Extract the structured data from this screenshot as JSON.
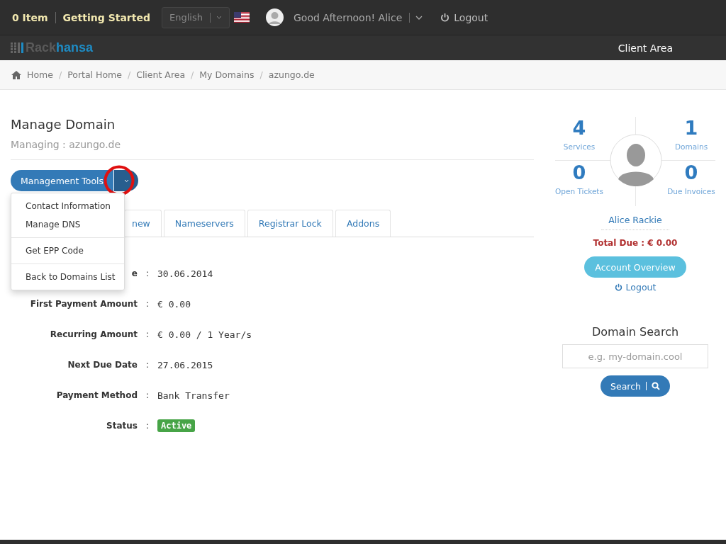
{
  "topbar": {
    "cart": "0 Item",
    "getting_started": "Getting Started",
    "language": "English",
    "greeting": "Good Afternoon! Alice",
    "logout": "Logout"
  },
  "navbar": {
    "logo_left": "Rack",
    "logo_right": "hansa",
    "link": "Client Area"
  },
  "breadcrumb": [
    {
      "kind": "link",
      "text": "Home"
    },
    {
      "kind": "separator",
      "text": "/"
    },
    {
      "kind": "link",
      "text": "Portal Home"
    },
    {
      "kind": "separator",
      "text": "/"
    },
    {
      "kind": "link",
      "text": "Client Area"
    },
    {
      "kind": "separator",
      "text": "/"
    },
    {
      "kind": "link",
      "text": "My Domains"
    },
    {
      "kind": "separator",
      "text": "/"
    },
    {
      "kind": "current",
      "text": "azungo.de"
    }
  ],
  "page": {
    "title": "Manage Domain",
    "subtitle": "Managing : azungo.de"
  },
  "tools": {
    "label": "Management Tools",
    "expanded": true,
    "highlighted": true,
    "menu": [
      {
        "label": "Contact Information",
        "divider_before": false
      },
      {
        "label": "Manage DNS",
        "divider_before": false
      },
      {
        "label": "Get EPP Code",
        "divider_before": true
      },
      {
        "label": "Back to Domains List",
        "divider_before": true
      }
    ]
  },
  "tabs": [
    {
      "label": "new",
      "selected": false
    },
    {
      "label": "Nameservers",
      "selected": false
    },
    {
      "label": "Registrar Lock",
      "selected": false
    },
    {
      "label": "Addons",
      "selected": false
    }
  ],
  "details": [
    {
      "label": "e",
      "separator": ":",
      "value": "30.06.2014",
      "kind": "text"
    },
    {
      "label": "First Payment Amount",
      "separator": ":",
      "value": "€ 0.00",
      "kind": "text"
    },
    {
      "label": "Recurring Amount",
      "separator": ":",
      "value": "€ 0.00 / 1 Year/s",
      "kind": "text"
    },
    {
      "label": "Next Due Date",
      "separator": ":",
      "value": "27.06.2015",
      "kind": "text"
    },
    {
      "label": "Payment Method",
      "separator": ":",
      "value": "Bank Transfer",
      "kind": "text"
    },
    {
      "label": "Status",
      "separator": ":",
      "value": "Active",
      "kind": "badge"
    }
  ],
  "sidebar": {
    "stats": [
      {
        "value": "4",
        "label": "Services"
      },
      {
        "value": "1",
        "label": "Domains"
      },
      {
        "value": "0",
        "label": "Open Tickets"
      },
      {
        "value": "0",
        "label": "Due Invoices"
      }
    ],
    "name": "Alice Rackie",
    "total_due": "Total Due : € 0.00",
    "overview_button": "Account Overview",
    "logout": "Logout",
    "search_title": "Domain Search",
    "search_placeholder": "e.g. my-domain.cool",
    "search_button": "Search"
  }
}
